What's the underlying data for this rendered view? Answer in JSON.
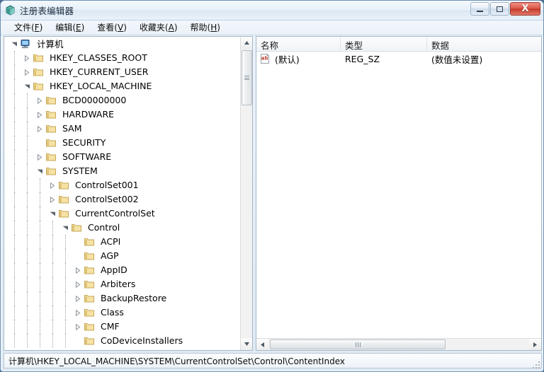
{
  "window": {
    "title": "注册表编辑器",
    "icon": "registry-editor-icon",
    "buttons": {
      "minimize": "—",
      "maximize": "□",
      "close": "X"
    }
  },
  "menubar": {
    "items": [
      {
        "label": "文件",
        "accel": "F"
      },
      {
        "label": "编辑",
        "accel": "E"
      },
      {
        "label": "查看",
        "accel": "V"
      },
      {
        "label": "收藏夹",
        "accel": "A"
      },
      {
        "label": "帮助",
        "accel": "H"
      }
    ]
  },
  "tree": {
    "nodes": [
      {
        "label": "计算机",
        "depth": 0,
        "state": "expanded",
        "icon": "computer-icon"
      },
      {
        "label": "HKEY_CLASSES_ROOT",
        "depth": 1,
        "state": "collapsed",
        "icon": "registry-key-icon"
      },
      {
        "label": "HKEY_CURRENT_USER",
        "depth": 1,
        "state": "collapsed",
        "icon": "registry-key-icon"
      },
      {
        "label": "HKEY_LOCAL_MACHINE",
        "depth": 1,
        "state": "expanded",
        "icon": "registry-key-icon"
      },
      {
        "label": "BCD00000000",
        "depth": 2,
        "state": "collapsed",
        "icon": "registry-key-icon"
      },
      {
        "label": "HARDWARE",
        "depth": 2,
        "state": "collapsed",
        "icon": "registry-key-icon"
      },
      {
        "label": "SAM",
        "depth": 2,
        "state": "collapsed",
        "icon": "registry-key-icon"
      },
      {
        "label": "SECURITY",
        "depth": 2,
        "state": "leaf",
        "icon": "registry-key-icon"
      },
      {
        "label": "SOFTWARE",
        "depth": 2,
        "state": "collapsed",
        "icon": "registry-key-icon"
      },
      {
        "label": "SYSTEM",
        "depth": 2,
        "state": "expanded",
        "icon": "registry-key-icon"
      },
      {
        "label": "ControlSet001",
        "depth": 3,
        "state": "collapsed",
        "icon": "registry-key-icon"
      },
      {
        "label": "ControlSet002",
        "depth": 3,
        "state": "collapsed",
        "icon": "registry-key-icon"
      },
      {
        "label": "CurrentControlSet",
        "depth": 3,
        "state": "expanded",
        "icon": "registry-key-icon"
      },
      {
        "label": "Control",
        "depth": 4,
        "state": "expanded",
        "icon": "registry-key-icon"
      },
      {
        "label": "ACPI",
        "depth": 5,
        "state": "leaf",
        "icon": "registry-key-icon"
      },
      {
        "label": "AGP",
        "depth": 5,
        "state": "leaf",
        "icon": "registry-key-icon"
      },
      {
        "label": "AppID",
        "depth": 5,
        "state": "collapsed",
        "icon": "registry-key-icon"
      },
      {
        "label": "Arbiters",
        "depth": 5,
        "state": "collapsed",
        "icon": "registry-key-icon"
      },
      {
        "label": "BackupRestore",
        "depth": 5,
        "state": "collapsed",
        "icon": "registry-key-icon"
      },
      {
        "label": "Class",
        "depth": 5,
        "state": "collapsed",
        "icon": "registry-key-icon"
      },
      {
        "label": "CMF",
        "depth": 5,
        "state": "collapsed",
        "icon": "registry-key-icon"
      },
      {
        "label": "CoDeviceInstallers",
        "depth": 5,
        "state": "leaf",
        "icon": "registry-key-icon"
      }
    ]
  },
  "list": {
    "columns": [
      {
        "label": "名称"
      },
      {
        "label": "类型"
      },
      {
        "label": "数据"
      }
    ],
    "rows": [
      {
        "name": "(默认)",
        "type": "REG_SZ",
        "data": "(数值未设置)",
        "icon": "string-value-icon"
      }
    ]
  },
  "statusbar": {
    "path": "计算机\\HKEY_LOCAL_MACHINE\\SYSTEM\\CurrentControlSet\\Control\\ContentIndex"
  },
  "colors": {
    "title_bar": "#e7f0f9",
    "close_button": "#c43a28",
    "folder": "#f2d98d",
    "computer_icon": "#3a6ea5",
    "pane_background": "#ffffff"
  }
}
